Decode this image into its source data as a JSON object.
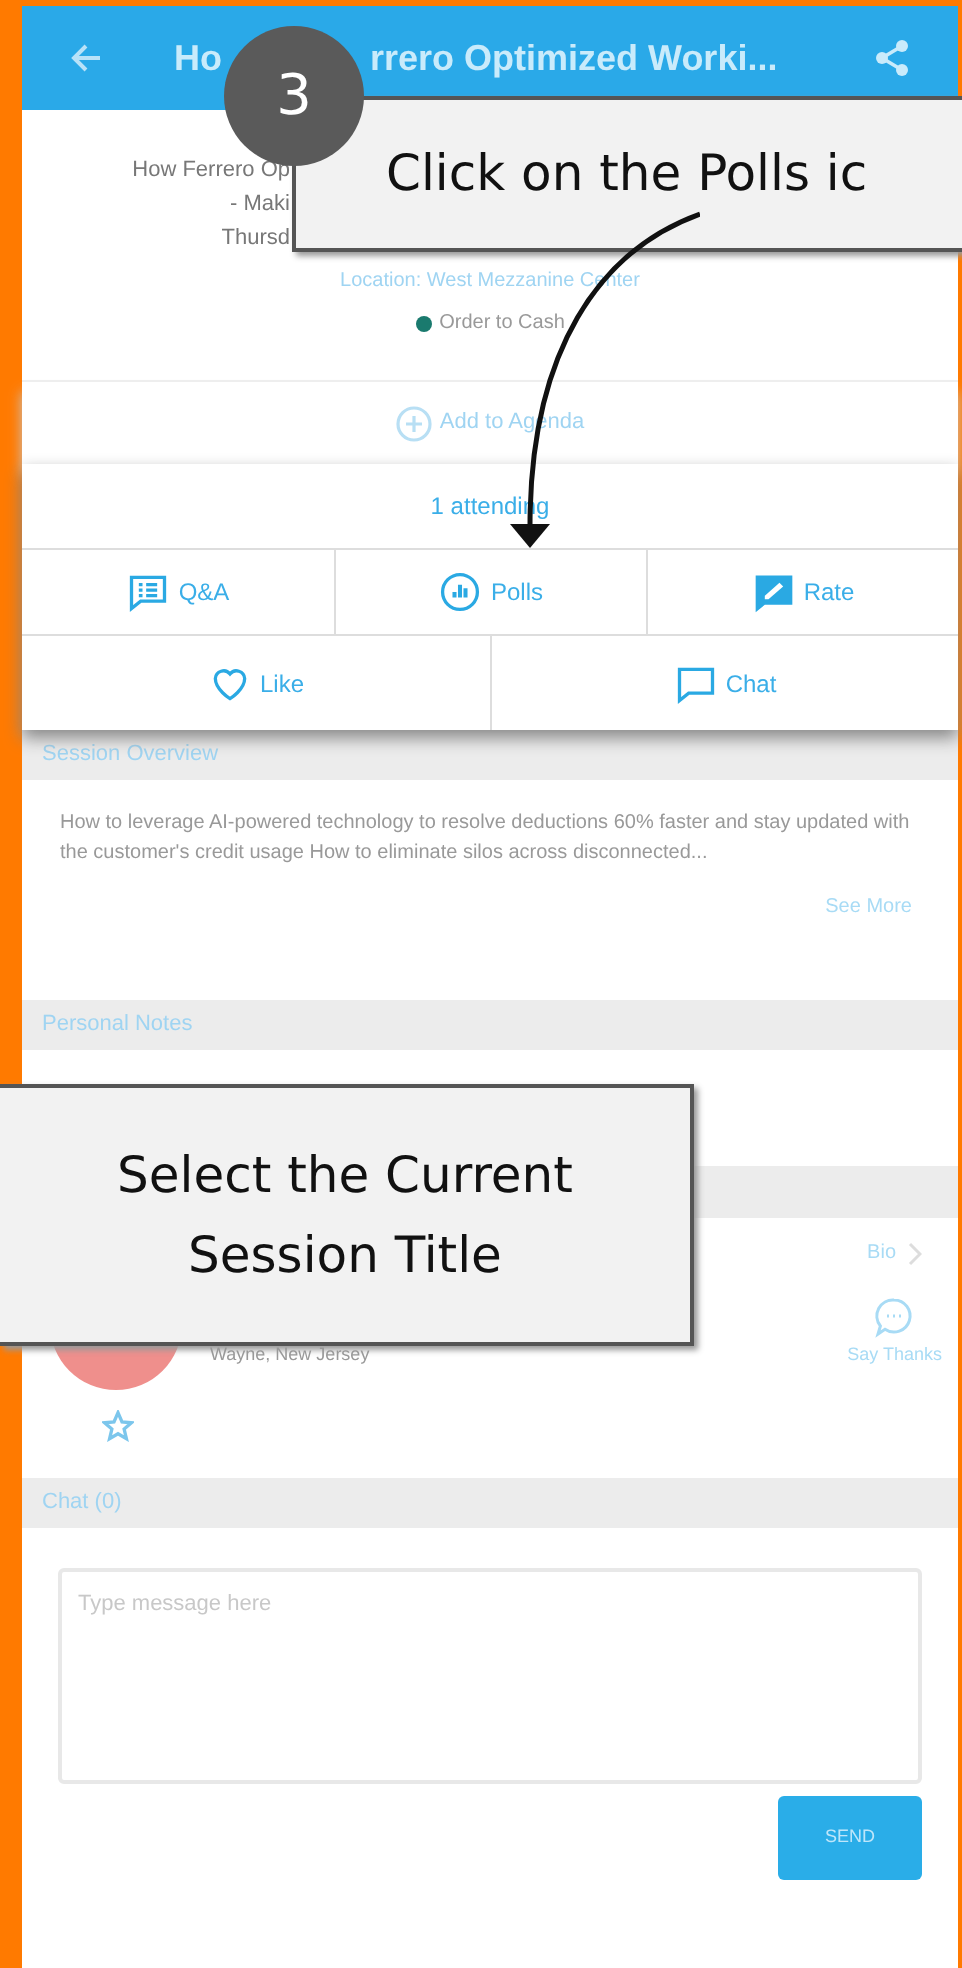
{
  "header": {
    "title_parts": [
      "Ho",
      "rrero Optimized Worki..."
    ]
  },
  "session": {
    "title_lines": [
      "How Ferrero Op",
      "- Maki",
      "Thursd"
    ],
    "location": "Location: West Mezzanine Center",
    "track": {
      "label": "Order to Cash",
      "color": "#1a7a6e"
    }
  },
  "add_to_agenda": "Add to Agenda",
  "attending": "1 attending",
  "actions": [
    {
      "label": "Q&A",
      "kind": "qa"
    },
    {
      "label": "Polls",
      "kind": "polls"
    },
    {
      "label": "Rate",
      "kind": "rate"
    }
  ],
  "social": [
    {
      "label": "Like",
      "kind": "like"
    },
    {
      "label": "Chat",
      "kind": "chat"
    }
  ],
  "overview": {
    "heading": "Session Overview",
    "text": "How to leverage AI-powered technology to resolve deductions 60% faster and stay updated with the customer's credit usage How to eliminate silos across disconnected...",
    "link": "See More"
  },
  "notes": {
    "heading": "Personal Notes"
  },
  "speaker": {
    "location": "Wayne, New Jersey",
    "bio": "Bio",
    "thanks": "Say Thanks",
    "starred": false
  },
  "chat": {
    "heading": "Chat (0)",
    "placeholder": "Type message here",
    "send": "SEND"
  },
  "callouts": [
    {
      "step": "3",
      "text": "Click on the Polls ic"
    },
    {
      "text": "Select the Current Session Title"
    }
  ]
}
